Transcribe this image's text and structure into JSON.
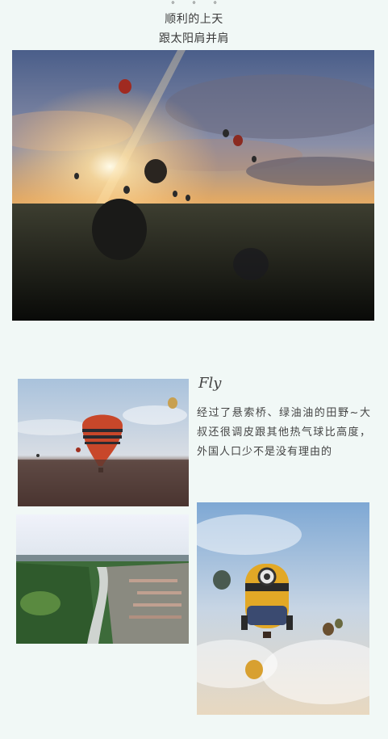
{
  "header": {
    "dots": "° ° °",
    "line1": "顺利的上天",
    "line2": "跟太阳肩并肩"
  },
  "fly": {
    "title": "Fly",
    "body": "经过了悬索桥、绿油油的田野~大叔还很调皮跟其他热气球比高度，外国人口少不是没有理由的"
  },
  "colors": {
    "background": "#f1f8f6",
    "text": "#444444"
  }
}
